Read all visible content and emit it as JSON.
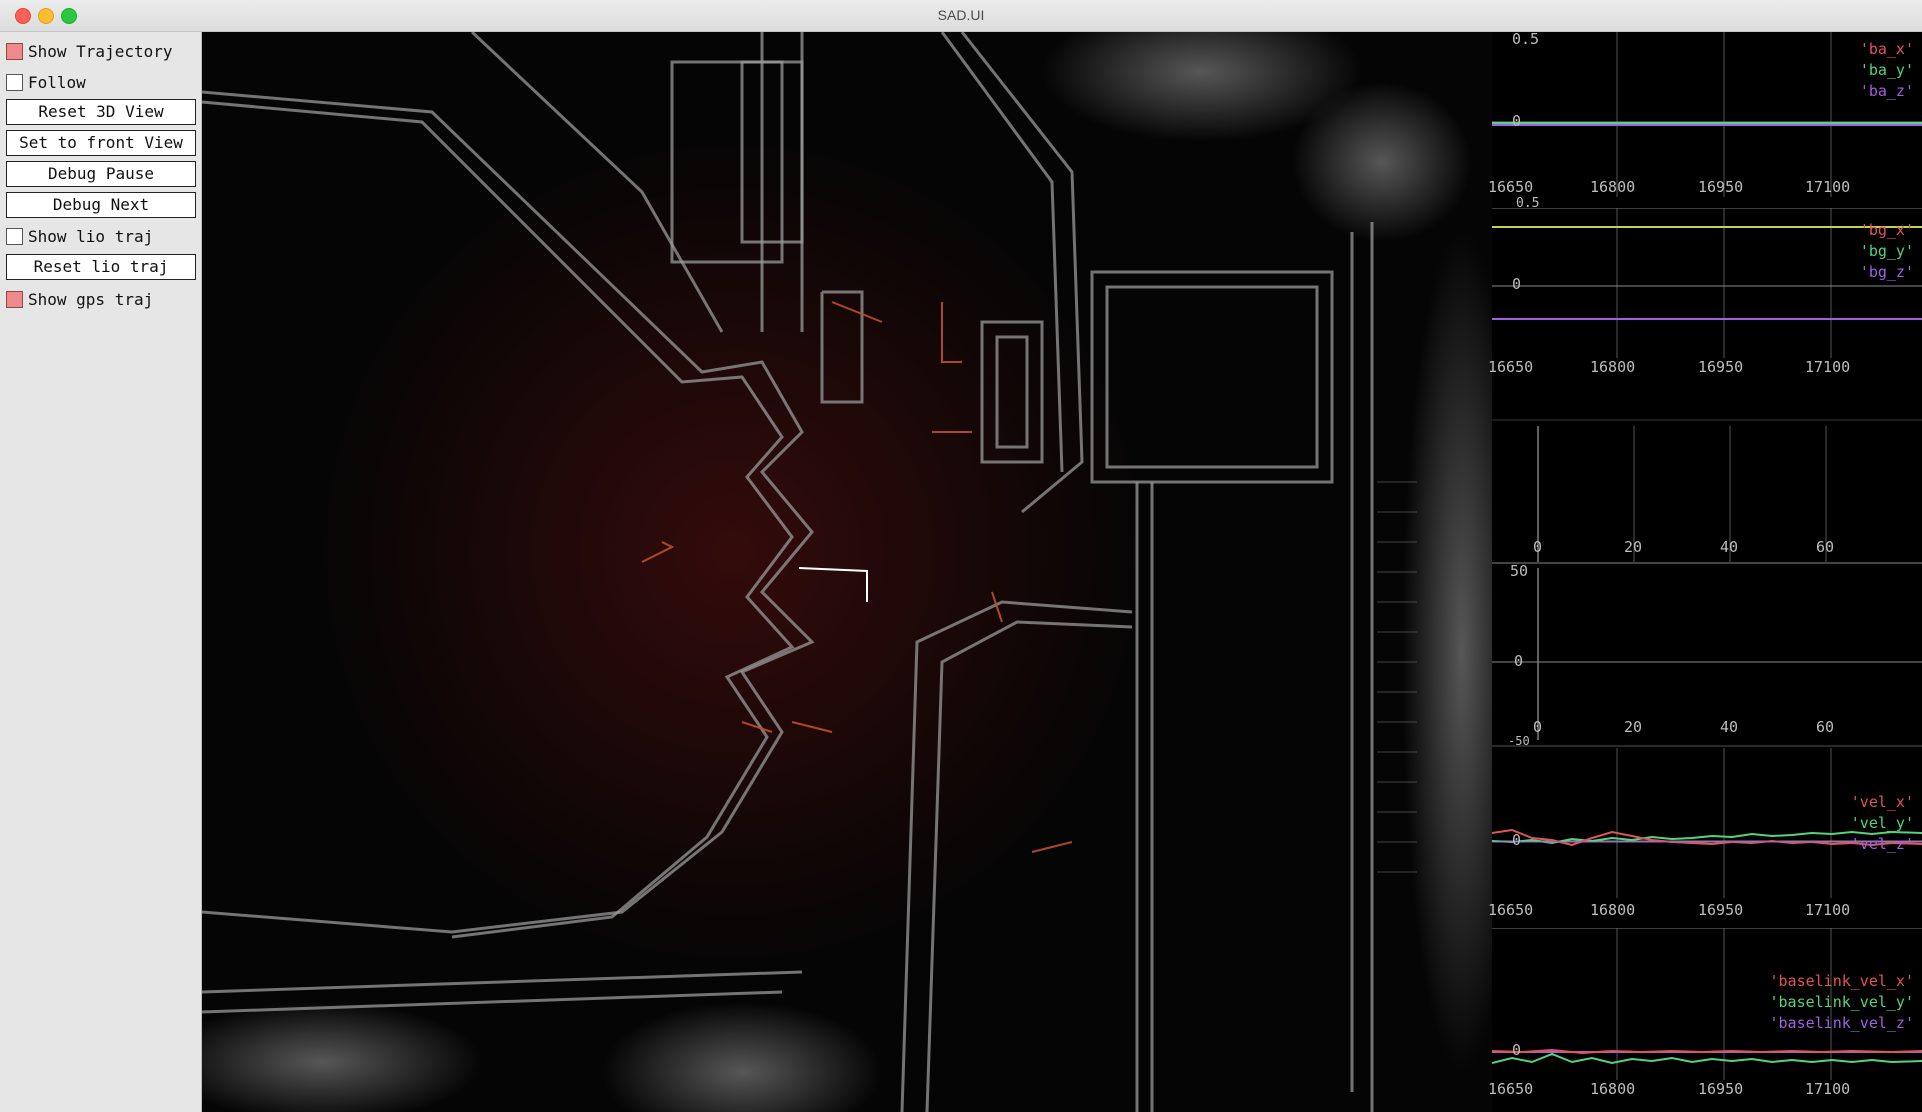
{
  "window": {
    "title": "SAD.UI"
  },
  "panel": {
    "show_trajectory": {
      "label": "Show Trajectory",
      "checked": true
    },
    "follow": {
      "label": "Follow",
      "checked": false
    },
    "reset_3d_view": "Reset 3D View",
    "set_front_view": "Set to front View",
    "debug_pause": "Debug Pause",
    "debug_next": "Debug Next",
    "show_lio_traj": {
      "label": "Show lio traj",
      "checked": false
    },
    "reset_lio_traj": "Reset lio traj",
    "show_gps_traj": {
      "label": "Show gps traj",
      "checked": true
    }
  },
  "colors": {
    "red": "#e05555",
    "green": "#55d47a",
    "purple": "#a060e0",
    "olive": "#bcd45a",
    "grid": "#5a5a5a",
    "axis": "#bdbdbd"
  },
  "plots": {
    "ba": {
      "y_top_label": "0.5",
      "y_zero_label": "0",
      "x_ticks": [
        "16650",
        "16800",
        "16950",
        "17100"
      ],
      "legend": [
        "'ba_x'",
        "'ba_y'",
        "'ba_z'"
      ]
    },
    "bg": {
      "y_top_label": "0.5",
      "y_zero_label": "0",
      "x_ticks": [
        "16650",
        "16800",
        "16950",
        "17100"
      ],
      "legend": [
        "'bg_x'",
        "'bg_y'",
        "'bg_z'"
      ]
    },
    "empty1": {
      "x_ticks": [
        "0",
        "20",
        "40",
        "60"
      ]
    },
    "empty2": {
      "x_ticks": [
        "0",
        "20",
        "40",
        "60"
      ],
      "y_labels": [
        "50",
        "0",
        "-50"
      ]
    },
    "vel": {
      "y_zero_label": "0",
      "x_ticks": [
        "16650",
        "16800",
        "16950",
        "17100"
      ],
      "legend": [
        "'vel_x'",
        "'vel_y'",
        "'vel_z'"
      ]
    },
    "baselink_vel": {
      "y_zero_label": "0",
      "x_ticks": [
        "16650",
        "16800",
        "16950",
        "17100"
      ],
      "legend": [
        "'baselink_vel_x'",
        "'baselink_vel_y'",
        "'baselink_vel_z'"
      ]
    }
  }
}
